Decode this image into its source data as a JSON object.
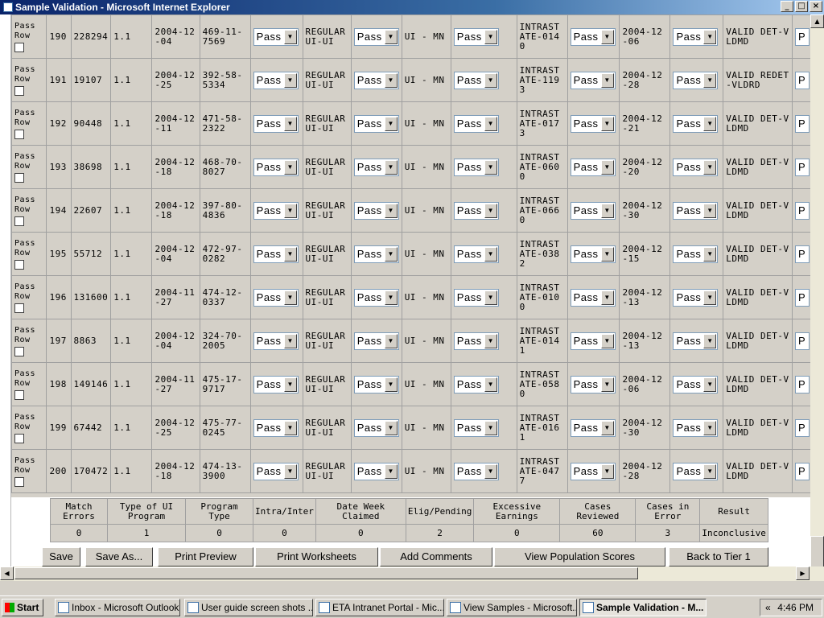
{
  "window": {
    "title": "Sample Validation - Microsoft Internet Explorer",
    "min": "_",
    "max": "□",
    "close": "×"
  },
  "pass_row_label": "Pass Row",
  "rows": [
    {
      "num": "190",
      "id": "228294",
      "ver": "1.1",
      "date1": "2004-12-04",
      "ssn": "469-11-7569",
      "sel1": "Pass",
      "prog": "REGULAR UI-UI",
      "sel2": "Pass",
      "state": "UI - MN",
      "sel3": "Pass",
      "inter": "INTRASTATE-0140",
      "sel4": "Pass",
      "date2": "2004-12-06",
      "sel5": "Pass",
      "valid": "VALID DET-VLDMD",
      "sel6": "P"
    },
    {
      "num": "191",
      "id": "19107",
      "ver": "1.1",
      "date1": "2004-12-25",
      "ssn": "392-58-5334",
      "sel1": "Pass",
      "prog": "REGULAR UI-UI",
      "sel2": "Pass",
      "state": "UI - MN",
      "sel3": "Pass",
      "inter": "INTRASTATE-1193",
      "sel4": "Pass",
      "date2": "2004-12-28",
      "sel5": "Pass",
      "valid": "VALID REDET-VLDRD",
      "sel6": "P"
    },
    {
      "num": "192",
      "id": "90448",
      "ver": "1.1",
      "date1": "2004-12-11",
      "ssn": "471-58-2322",
      "sel1": "Pass",
      "prog": "REGULAR UI-UI",
      "sel2": "Pass",
      "state": "UI - MN",
      "sel3": "Pass",
      "inter": "INTRASTATE-0173",
      "sel4": "Pass",
      "date2": "2004-12-21",
      "sel5": "Pass",
      "valid": "VALID DET-VLDMD",
      "sel6": "P"
    },
    {
      "num": "193",
      "id": "38698",
      "ver": "1.1",
      "date1": "2004-12-18",
      "ssn": "468-70-8027",
      "sel1": "Pass",
      "prog": "REGULAR UI-UI",
      "sel2": "Pass",
      "state": "UI - MN",
      "sel3": "Pass",
      "inter": "INTRASTATE-0600",
      "sel4": "Pass",
      "date2": "2004-12-20",
      "sel5": "Pass",
      "valid": "VALID DET-VLDMD",
      "sel6": "P"
    },
    {
      "num": "194",
      "id": "22607",
      "ver": "1.1",
      "date1": "2004-12-18",
      "ssn": "397-80-4836",
      "sel1": "Pass",
      "prog": "REGULAR UI-UI",
      "sel2": "Pass",
      "state": "UI - MN",
      "sel3": "Pass",
      "inter": "INTRASTATE-0660",
      "sel4": "Pass",
      "date2": "2004-12-30",
      "sel5": "Pass",
      "valid": "VALID DET-VLDMD",
      "sel6": "P"
    },
    {
      "num": "195",
      "id": "55712",
      "ver": "1.1",
      "date1": "2004-12-04",
      "ssn": "472-97-0282",
      "sel1": "Pass",
      "prog": "REGULAR UI-UI",
      "sel2": "Pass",
      "state": "UI - MN",
      "sel3": "Pass",
      "inter": "INTRASTATE-0382",
      "sel4": "Pass",
      "date2": "2004-12-15",
      "sel5": "Pass",
      "valid": "VALID DET-VLDMD",
      "sel6": "P"
    },
    {
      "num": "196",
      "id": "131600",
      "ver": "1.1",
      "date1": "2004-11-27",
      "ssn": "474-12-0337",
      "sel1": "Pass",
      "prog": "REGULAR UI-UI",
      "sel2": "Pass",
      "state": "UI - MN",
      "sel3": "Pass",
      "inter": "INTRASTATE-0100",
      "sel4": "Pass",
      "date2": "2004-12-13",
      "sel5": "Pass",
      "valid": "VALID DET-VLDMD",
      "sel6": "P"
    },
    {
      "num": "197",
      "id": "8863",
      "ver": "1.1",
      "date1": "2004-12-04",
      "ssn": "324-70-2005",
      "sel1": "Pass",
      "prog": "REGULAR UI-UI",
      "sel2": "Pass",
      "state": "UI - MN",
      "sel3": "Pass",
      "inter": "INTRASTATE-0141",
      "sel4": "Pass",
      "date2": "2004-12-13",
      "sel5": "Pass",
      "valid": "VALID DET-VLDMD",
      "sel6": "P"
    },
    {
      "num": "198",
      "id": "149146",
      "ver": "1.1",
      "date1": "2004-11-27",
      "ssn": "475-17-9717",
      "sel1": "Pass",
      "prog": "REGULAR UI-UI",
      "sel2": "Pass",
      "state": "UI - MN",
      "sel3": "Pass",
      "inter": "INTRASTATE-0580",
      "sel4": "Pass",
      "date2": "2004-12-06",
      "sel5": "Pass",
      "valid": "VALID DET-VLDMD",
      "sel6": "P"
    },
    {
      "num": "199",
      "id": "67442",
      "ver": "1.1",
      "date1": "2004-12-25",
      "ssn": "475-77-0245",
      "sel1": "Pass",
      "prog": "REGULAR UI-UI",
      "sel2": "Pass",
      "state": "UI - MN",
      "sel3": "Pass",
      "inter": "INTRASTATE-0161",
      "sel4": "Pass",
      "date2": "2004-12-30",
      "sel5": "Pass",
      "valid": "VALID DET-VLDMD",
      "sel6": "P"
    },
    {
      "num": "200",
      "id": "170472",
      "ver": "1.1",
      "date1": "2004-12-18",
      "ssn": "474-13-3900",
      "sel1": "Pass",
      "prog": "REGULAR UI-UI",
      "sel2": "Pass",
      "state": "UI - MN",
      "sel3": "Pass",
      "inter": "INTRASTATE-0477",
      "sel4": "Pass",
      "date2": "2004-12-28",
      "sel5": "Pass",
      "valid": "VALID DET-VLDMD",
      "sel6": "P"
    }
  ],
  "summary": {
    "headers": [
      "Match Errors",
      "Type of UI Program",
      "Program Type",
      "Intra/Inter",
      "Date Week Claimed",
      "Elig/Pending",
      "Excessive Earnings",
      "Cases Reviewed",
      "Cases in Error",
      "Result"
    ],
    "values": [
      "0",
      "1",
      "0",
      "0",
      "0",
      "2",
      "0",
      "60",
      "3",
      "Inconclusive"
    ]
  },
  "buttons": {
    "save": "Save",
    "save_as": "Save As...",
    "print_preview": "Print Preview",
    "print_worksheets": "Print Worksheets",
    "add_comments": "Add Comments",
    "view_population": "View Population Scores",
    "back": "Back to Tier 1"
  },
  "taskbar": {
    "start": "Start",
    "items": [
      "Inbox - Microsoft Outlook",
      "User guide screen shots ...",
      "ETA Intranet Portal - Mic...",
      "View Samples - Microsoft...",
      "Sample Validation - M..."
    ],
    "chevron": "«",
    "time": "4:46 PM"
  }
}
